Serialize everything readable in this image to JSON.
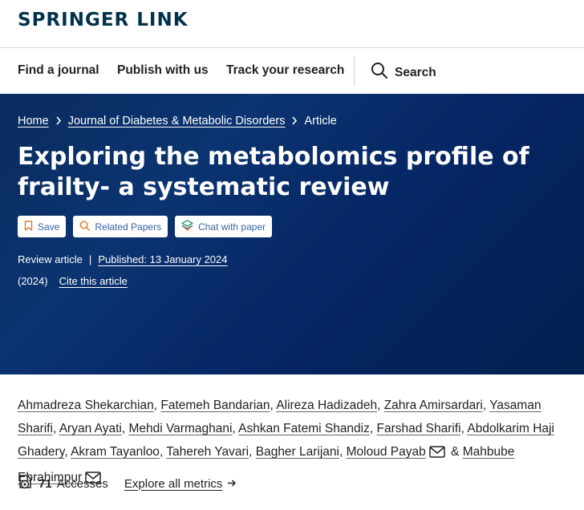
{
  "header": {
    "logo": "SPRINGER LINK"
  },
  "nav": {
    "items": [
      {
        "label": "Find a journal"
      },
      {
        "label": "Publish with us"
      },
      {
        "label": "Track your research"
      }
    ],
    "search_label": "Search"
  },
  "breadcrumb": {
    "items": [
      "Home",
      "Journal of Diabetes & Metabolic Disorders"
    ],
    "current": "Article"
  },
  "article": {
    "title": "Exploring the metabolomics profile of frailty- a systematic review",
    "actions": [
      "Save",
      "Related Papers",
      "Chat with paper"
    ],
    "type": "Review article",
    "published": "Published: 13 January 2024",
    "year": "(2024)",
    "cite": "Cite this article"
  },
  "authors": [
    "Ahmadreza Shekarchian",
    "Fatemeh Bandarian",
    "Alireza Hadizadeh",
    "Zahra Amirsardari",
    "Yasaman Sharifi",
    "Aryan Ayati",
    "Mehdi Varmaghani",
    "Ashkan Fatemi Shandiz",
    "Farshad Sharifi",
    "Abdolkarim Haji Ghadery",
    "Akram Tayanloo",
    "Tahereh Yavari",
    "Bagher Larijani",
    "Moloud Payab",
    "Mahbube Ebrahimpur"
  ],
  "authors_joiner": "&",
  "metrics": {
    "accesses_count": "71",
    "accesses_label": "Accesses",
    "explore_label": "Explore all metrics"
  },
  "colors": {
    "brand": "#01324b",
    "hero_dark": "#052563",
    "action_text": "#3363a8",
    "save_icon": "#e0792b"
  }
}
